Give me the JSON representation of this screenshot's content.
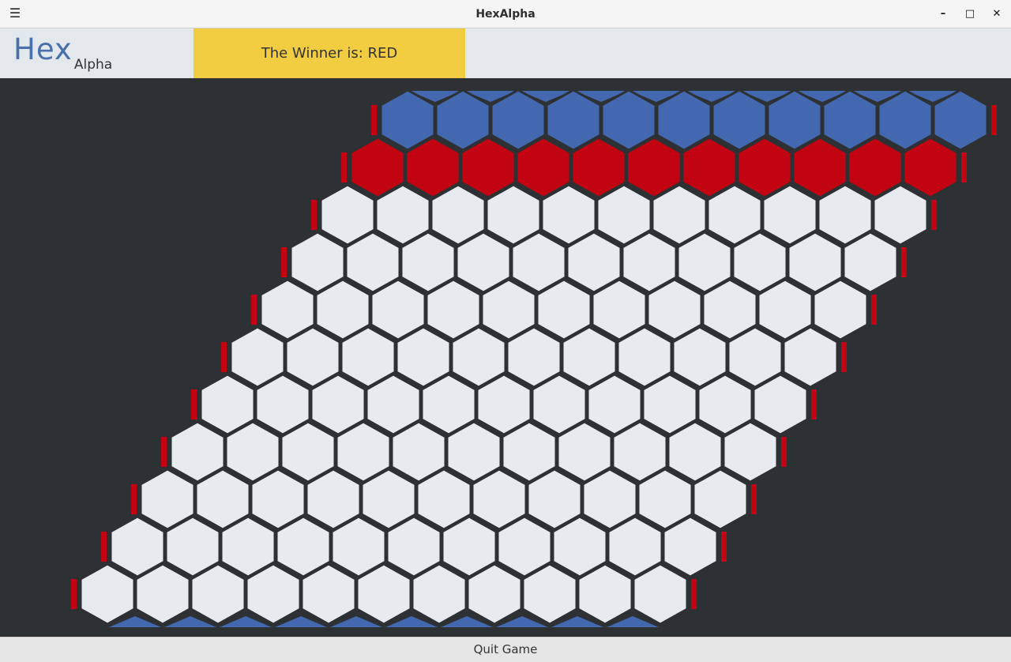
{
  "window": {
    "title": "HexAlpha"
  },
  "titlebar": {
    "menu_icon": "hamburger-icon",
    "min_icon": "minimize-icon",
    "max_icon": "maximize-icon",
    "close_icon": "close-icon"
  },
  "header": {
    "logo_main": "Hex",
    "logo_sub": "Alpha",
    "winner_text": "The Winner is: RED"
  },
  "colors": {
    "blue": "#4368b0",
    "red": "#c20412",
    "empty": "#e7eaee",
    "board_bg": "#2d3133",
    "winner_banner": "#f2cd41"
  },
  "board": {
    "size": 11,
    "rows": [
      [
        "B",
        "B",
        "B",
        "B",
        "B",
        "B",
        "B",
        "B",
        "B",
        "B",
        "B"
      ],
      [
        "R",
        "R",
        "R",
        "R",
        "R",
        "R",
        "R",
        "R",
        "R",
        "R",
        "R"
      ],
      [
        "E",
        "E",
        "E",
        "E",
        "E",
        "E",
        "E",
        "E",
        "E",
        "E",
        "E"
      ],
      [
        "E",
        "E",
        "E",
        "E",
        "E",
        "E",
        "E",
        "E",
        "E",
        "E",
        "E"
      ],
      [
        "E",
        "E",
        "E",
        "E",
        "E",
        "E",
        "E",
        "E",
        "E",
        "E",
        "E"
      ],
      [
        "E",
        "E",
        "E",
        "E",
        "E",
        "E",
        "E",
        "E",
        "E",
        "E",
        "E"
      ],
      [
        "E",
        "E",
        "E",
        "E",
        "E",
        "E",
        "E",
        "E",
        "E",
        "E",
        "E"
      ],
      [
        "E",
        "E",
        "E",
        "E",
        "E",
        "E",
        "E",
        "E",
        "E",
        "E",
        "E"
      ],
      [
        "E",
        "E",
        "E",
        "E",
        "E",
        "E",
        "E",
        "E",
        "E",
        "E",
        "E"
      ],
      [
        "E",
        "E",
        "E",
        "E",
        "E",
        "E",
        "E",
        "E",
        "E",
        "E",
        "E"
      ],
      [
        "E",
        "E",
        "E",
        "E",
        "E",
        "E",
        "E",
        "E",
        "E",
        "E",
        "E"
      ]
    ]
  },
  "footer": {
    "quit_label": "Quit Game"
  }
}
